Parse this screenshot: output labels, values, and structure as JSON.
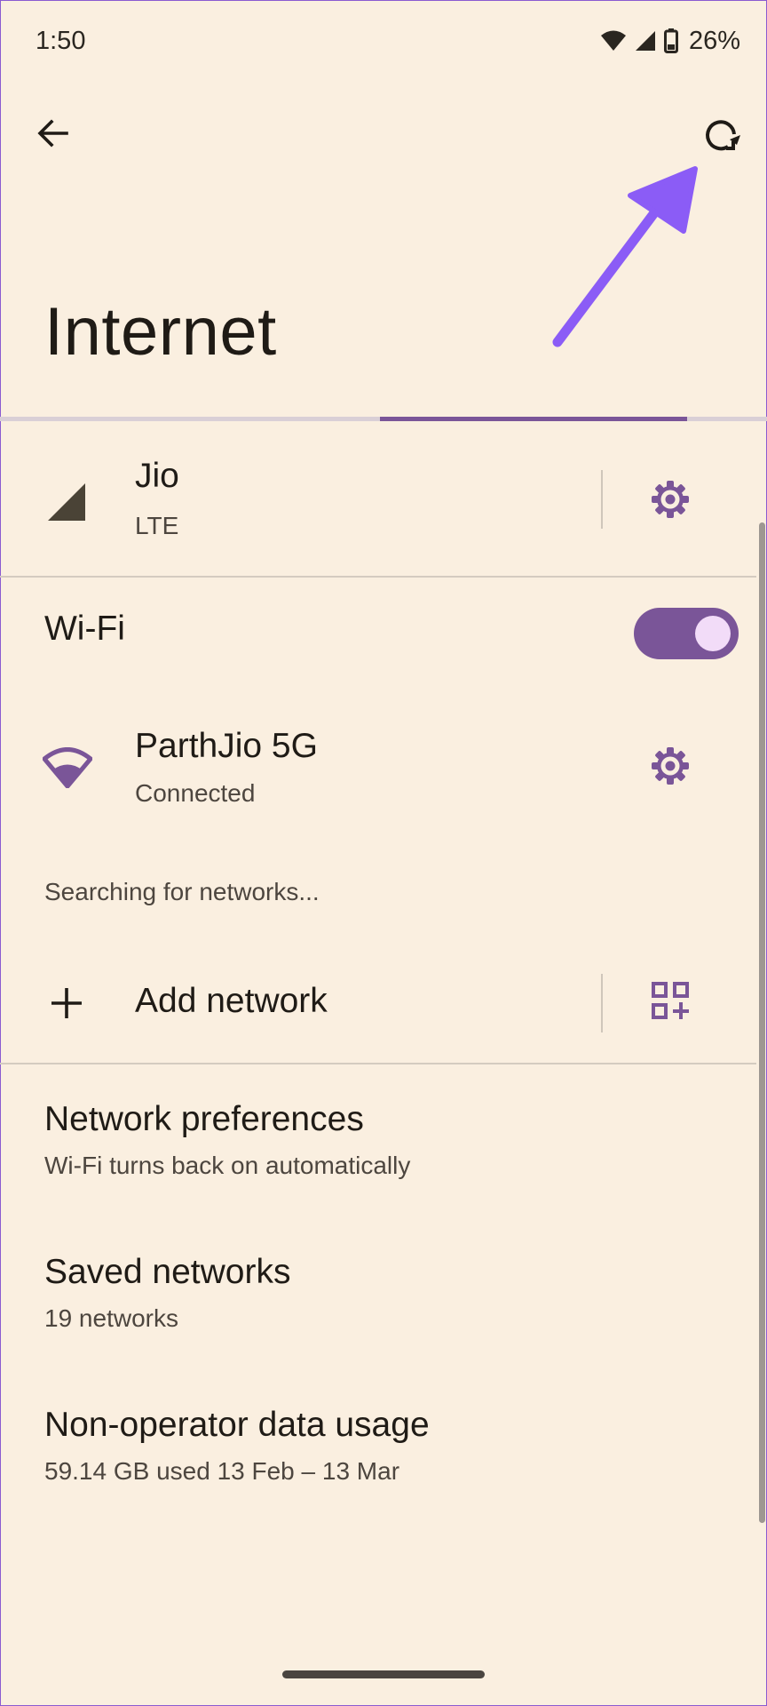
{
  "status_bar": {
    "time": "1:50",
    "battery": "26%",
    "icons": [
      "wifi-icon",
      "cell-signal-icon",
      "battery-icon"
    ]
  },
  "toolbar": {
    "back_icon": "back-arrow-icon",
    "refresh_icon": "refresh-icon"
  },
  "annotation": {
    "type": "arrow",
    "color": "#8b5cf6",
    "points_to": "refresh-icon"
  },
  "page": {
    "title": "Internet"
  },
  "scan_progress": {
    "indeterminate": true
  },
  "mobile": {
    "name": "Jio",
    "type": "LTE",
    "icon": "cell-signal-icon",
    "settings_icon": "gear-icon"
  },
  "wifi": {
    "label": "Wi-Fi",
    "enabled": true,
    "connected_network": {
      "name": "ParthJio 5G",
      "status": "Connected",
      "icon": "wifi-icon",
      "settings_icon": "gear-icon"
    },
    "scanning_text": "Searching for networks...",
    "add_network": {
      "label": "Add network",
      "icon": "plus-icon",
      "qr_icon": "qr-code-scanner-icon"
    }
  },
  "settings": [
    {
      "title": "Network preferences",
      "subtitle": "Wi-Fi turns back on automatically"
    },
    {
      "title": "Saved networks",
      "subtitle": "19 networks"
    },
    {
      "title": "Non-operator data usage",
      "subtitle": "59.14 GB used 13 Feb – 13 Mar"
    }
  ],
  "colors": {
    "background": "#faefe0",
    "accent": "#7a5598",
    "toggle_knob": "#f2dcf8",
    "annotation": "#8b5cf6"
  }
}
